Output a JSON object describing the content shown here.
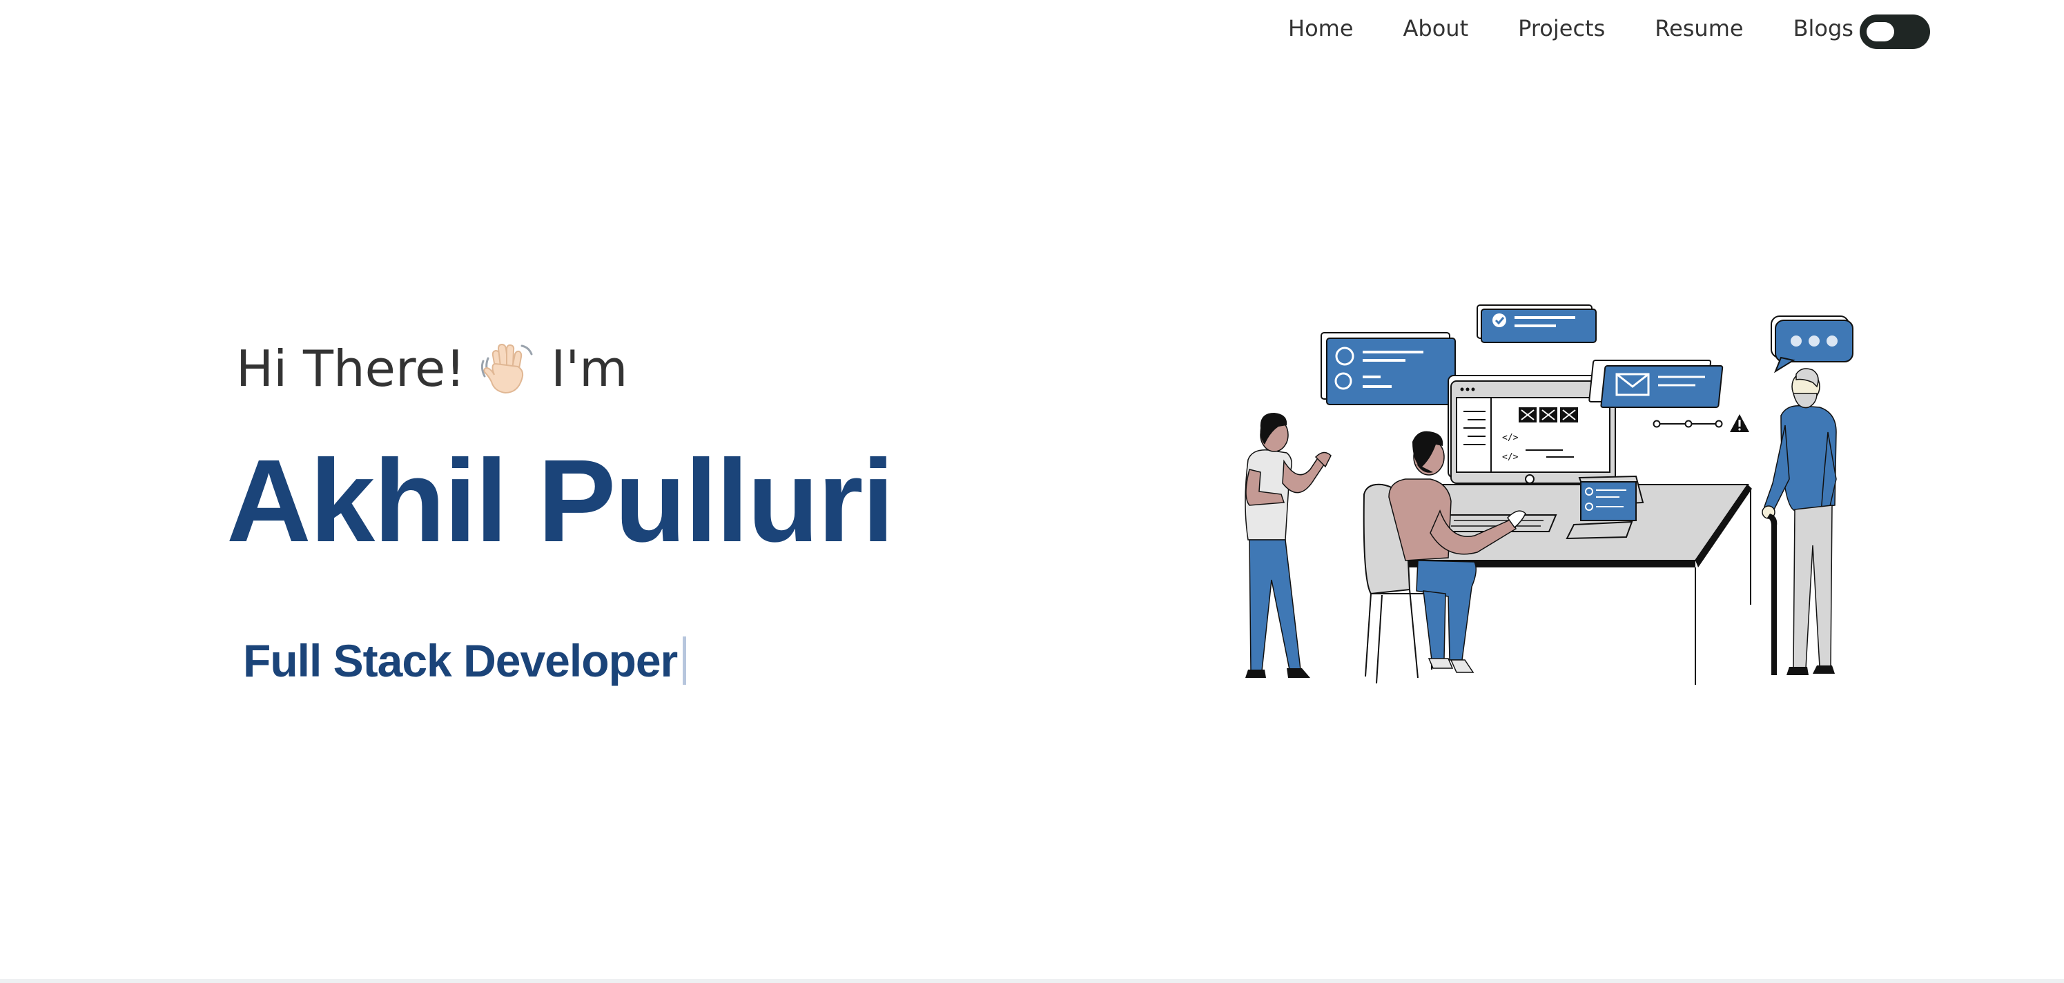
{
  "nav": {
    "links": [
      "Home",
      "About",
      "Projects",
      "Resume",
      "Blogs"
    ],
    "theme_toggle_state": "dark"
  },
  "hero": {
    "greeting_prefix": "Hi There!",
    "greeting_suffix": "I'm",
    "wave_icon": "waving-hand-icon",
    "name": "Akhil Pulluri",
    "typed_role": "Full Stack Developer"
  },
  "illustration": {
    "icon": "developers-at-workstation-illustration",
    "monitor_code_labels": [
      "</>",
      "</>"
    ]
  },
  "colors": {
    "accent": "#1b4479",
    "illustration_blue": "#3f78b5",
    "text": "#333333",
    "toggle": "#1f2624"
  }
}
